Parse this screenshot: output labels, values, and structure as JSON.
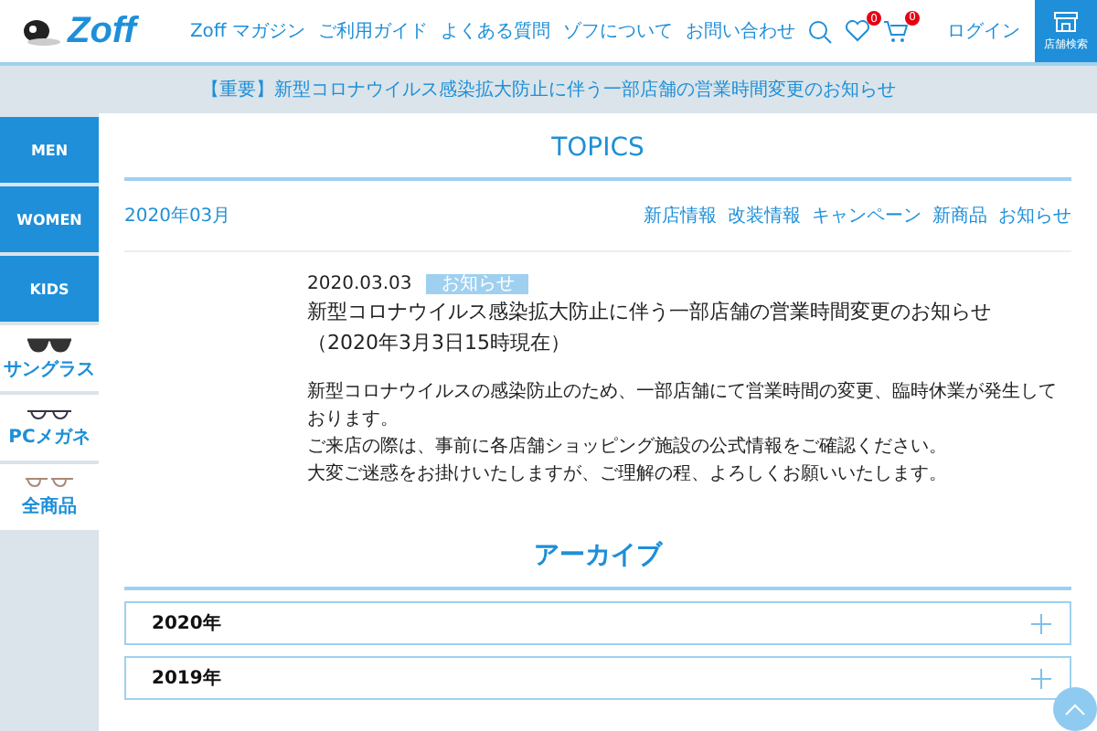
{
  "header": {
    "logo": "Zoff",
    "nav": [
      "Zoff マガジン",
      "ご利用ガイド",
      "よくある質問",
      "ゾフについて",
      "お問い合わせ"
    ],
    "favorites_count": "0",
    "cart_count": "0",
    "login": "ログイン",
    "store_search": "店舗検索"
  },
  "notice": "【重要】新型コロナウイルス感染拡大防止に伴う一部店舗の営業時間変更のお知らせ",
  "sidebar": [
    {
      "kind": "text",
      "label": "MEN"
    },
    {
      "kind": "text",
      "label": "WOMEN"
    },
    {
      "kind": "text",
      "label": "KIDS"
    },
    {
      "kind": "sunglasses",
      "label": "サングラス"
    },
    {
      "kind": "pcglasses",
      "label": "PCメガネ"
    },
    {
      "kind": "all",
      "label": "全商品"
    }
  ],
  "topics": {
    "title": "TOPICS",
    "month": "2020年03月",
    "categories": [
      "新店情報",
      "改装情報",
      "キャンペーン",
      "新商品",
      "お知らせ"
    ],
    "article": {
      "date": "2020.03.03",
      "tag": "お知らせ",
      "title": "新型コロナウイルス感染拡大防止に伴う一部店舗の営業時間変更のお知らせ",
      "subtitle": "（2020年3月3日15時現在）",
      "body": [
        "新型コロナウイルスの感染防止のため、一部店舗にて営業時間の変更、臨時休業が発生しております。",
        "ご来店の際は、事前に各店舗ショッピング施設の公式情報をご確認ください。",
        "大変ご迷惑をお掛けいたしますが、ご理解の程、よろしくお願いいたします。"
      ]
    }
  },
  "archive": {
    "title": "アーカイブ",
    "years": [
      {
        "label": "2020年",
        "expanded": false
      },
      {
        "label": "2019年",
        "expanded": false
      }
    ]
  }
}
